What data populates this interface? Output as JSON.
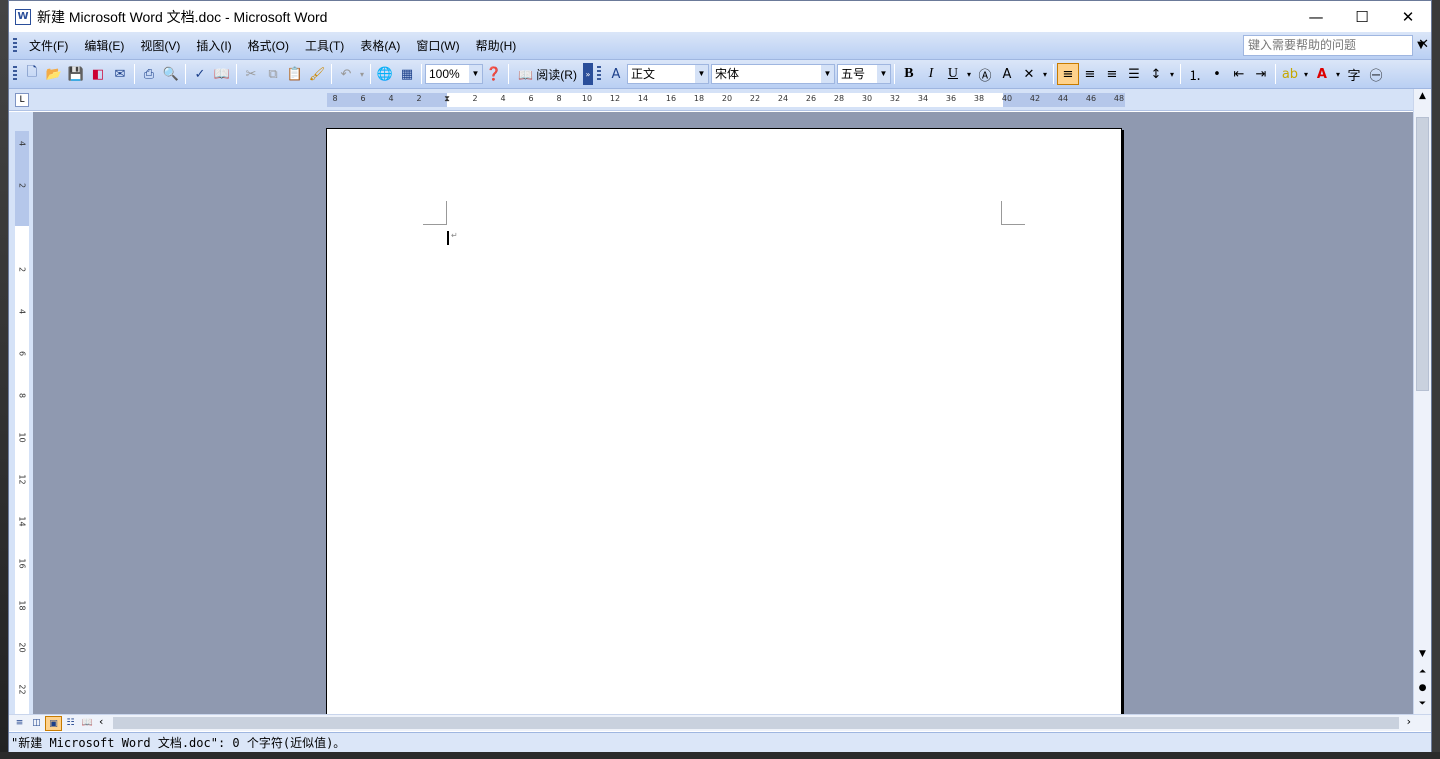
{
  "window": {
    "title": "新建 Microsoft Word 文档.doc - Microsoft Word",
    "app_icon": "W",
    "controls": {
      "minimize": "—",
      "maximize": "☐",
      "close": "✕"
    }
  },
  "menubar": {
    "items": [
      "文件(F)",
      "编辑(E)",
      "视图(V)",
      "插入(I)",
      "格式(O)",
      "工具(T)",
      "表格(A)",
      "窗口(W)",
      "帮助(H)"
    ],
    "help_placeholder": "键入需要帮助的问题",
    "help_close": "✕"
  },
  "toolbar": {
    "zoom": "100%",
    "read_label": "阅读(R)",
    "style": "正文",
    "font": "宋体",
    "size": "五号",
    "bold": "B",
    "italic": "I",
    "underline": "U"
  },
  "ruler": {
    "corner": "L",
    "h_numbers": [
      "8",
      "6",
      "4",
      "2",
      "2",
      "4",
      "6",
      "8",
      "10",
      "12",
      "14",
      "16",
      "18",
      "20",
      "22",
      "24",
      "26",
      "28",
      "30",
      "32",
      "34",
      "36",
      "38",
      "40",
      "42",
      "44",
      "46",
      "48"
    ],
    "v_numbers": [
      "4",
      "2",
      "2",
      "4",
      "6",
      "8",
      "10",
      "12",
      "14",
      "16",
      "18",
      "20",
      "22"
    ]
  },
  "statusbar": {
    "text": "\"新建 Microsoft Word 文档.doc\": 0 个字符(近似值)。"
  },
  "accent_colors": {
    "bar": "#c6d7f4",
    "doc_bg": "#8f99b0",
    "active": "#ffd28c"
  }
}
